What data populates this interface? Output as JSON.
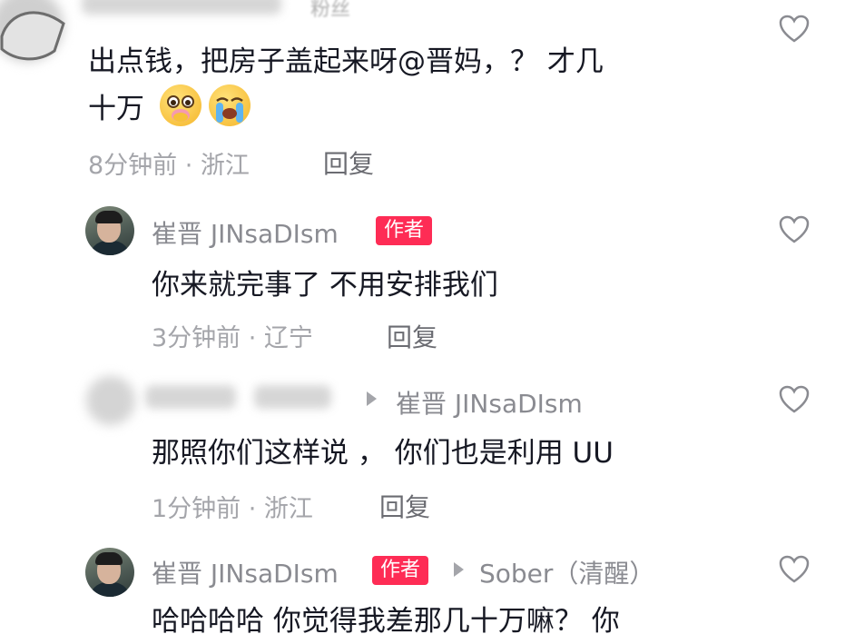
{
  "comments": [
    {
      "top_label": "粉丝",
      "content_line1": "出点钱，把房子盖起来呀@晋妈，？ 才几",
      "content_line2": "十万",
      "emojis": [
        "pleading-face-icon",
        "loudly-crying-face-icon"
      ],
      "time_location": "8分钟前 · 浙江",
      "reply_label": "回复"
    },
    {
      "nickname": "崔晋 JINsaDIsm",
      "badge": "作者",
      "content": "你来就完事了 不用安排我们",
      "time_location": "3分钟前 · 辽宁",
      "reply_label": "回复"
    },
    {
      "reply_to": "崔晋 JINsaDIsm",
      "content": "那照你们这样说 ， 你们也是利用 UU",
      "time_location": "1分钟前 · 浙江",
      "reply_label": "回复"
    },
    {
      "nickname": "崔晋 JINsaDIsm",
      "badge": "作者",
      "reply_to": "Sober（清醒）",
      "content": "哈哈哈哈 你觉得我差那几十万嘛？ 你"
    }
  ],
  "colors": {
    "badge_bg": "#fe2c55",
    "secondary_text": "#a4a5aa",
    "primary_text": "#161823"
  }
}
